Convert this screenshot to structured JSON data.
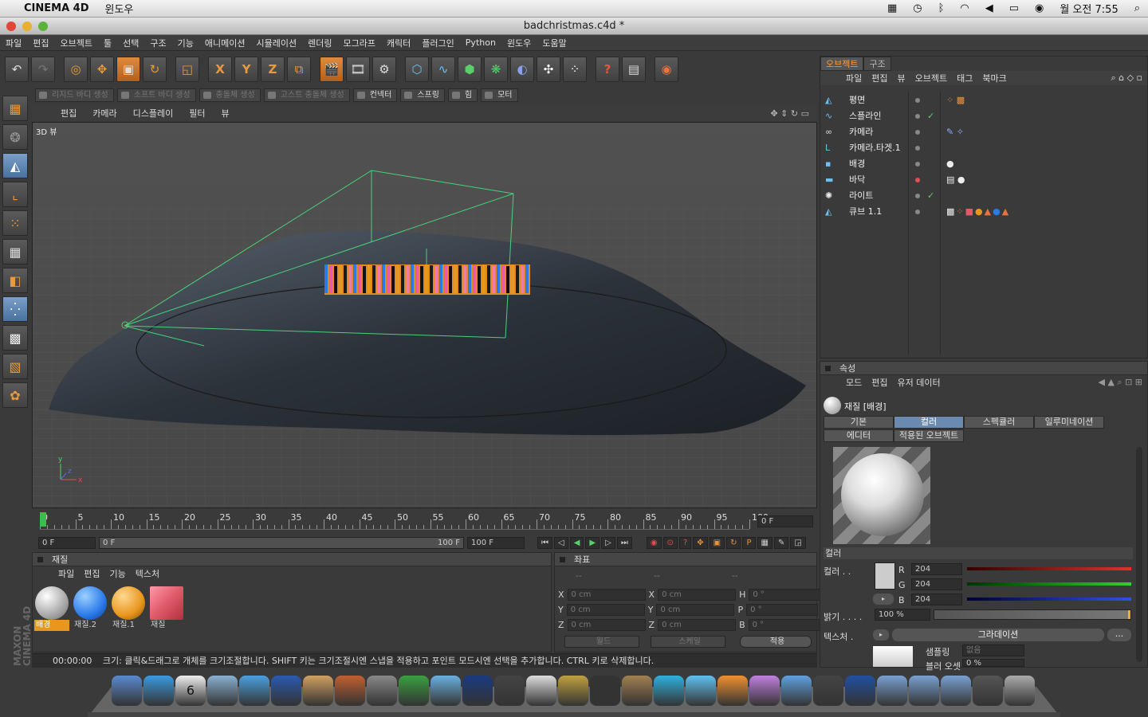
{
  "mac_menubar": {
    "app_name": "CINEMA 4D",
    "window_menu": "윈도우",
    "clock": "월 오전 7:55"
  },
  "window": {
    "title": "badchristmas.c4d *"
  },
  "c4d_menu": [
    "파일",
    "편집",
    "오브젝트",
    "툴",
    "선택",
    "구조",
    "기능",
    "애니메이션",
    "시뮬레이션",
    "렌더링",
    "모그라프",
    "캐릭터",
    "플러그인",
    "Python",
    "윈도우",
    "도움말"
  ],
  "toolbar": {
    "icons": [
      "undo-icon",
      "redo-icon",
      "live-select-icon",
      "move-icon",
      "scale-icon",
      "rotate-icon",
      "model-mode-icon",
      "x-axis-icon",
      "y-axis-icon",
      "z-axis-icon",
      "coord-system-icon",
      "render-view-icon",
      "render-picture-icon",
      "render-settings-icon",
      "cube-icon",
      "spline-icon",
      "nurbs-icon",
      "array-icon",
      "deformer-icon",
      "scene-icon",
      "particles-icon",
      "help-icon",
      "script-icon",
      "web-icon"
    ],
    "glyphs": [
      "↶",
      "↷",
      "◎",
      "✥",
      "▣",
      "↻",
      "◱",
      "X",
      "Y",
      "Z",
      "⧉",
      "🎬",
      "🎞",
      "⚙",
      "⬡",
      "∿",
      "⬢",
      "❋",
      "◐",
      "✣",
      "⁘",
      "?",
      "▤",
      "◉"
    ]
  },
  "dynamics_bar": [
    "리지드 바디 생성",
    "소프트 바디 생성",
    "충돌체 생성",
    "고스트 충돌체 생성",
    "컨넥터",
    "스프링",
    "힘",
    "모터"
  ],
  "viewport": {
    "menu": [
      "편집",
      "카메라",
      "디스플레이",
      "필터",
      "뷰"
    ],
    "label": "3D 뷰",
    "axis_x": "x",
    "axis_y": "y",
    "axis_z": "z"
  },
  "timeline": {
    "ticks": [
      "0",
      "5",
      "10",
      "15",
      "20",
      "25",
      "30",
      "35",
      "40",
      "45",
      "50",
      "55",
      "60",
      "65",
      "70",
      "75",
      "80",
      "85",
      "90",
      "95",
      "100"
    ],
    "current_frame": "0 F",
    "start": "0 F",
    "range_start": "0 F",
    "range_end": "100 F",
    "end": "100 F"
  },
  "material_panel": {
    "title": "재질",
    "menu": [
      "파일",
      "편집",
      "기능",
      "텍스처"
    ],
    "materials": [
      {
        "name": "배경",
        "color": "#e8e8e8",
        "selected": true
      },
      {
        "name": "재질.2",
        "color": "#2a7ae8",
        "selected": false
      },
      {
        "name": "재질.1",
        "color": "#e8961e",
        "selected": false
      },
      {
        "name": "재질",
        "color": "#e05a6a",
        "selected": false
      }
    ]
  },
  "coord_panel": {
    "title": "좌표",
    "headers": [
      "--",
      "--",
      "--"
    ],
    "rows": [
      {
        "a": "X",
        "a_val": "0 cm",
        "b": "X",
        "b_val": "0 cm",
        "c": "H",
        "c_val": "0 °"
      },
      {
        "a": "Y",
        "a_val": "0 cm",
        "b": "Y",
        "b_val": "0 cm",
        "c": "P",
        "c_val": "0 °"
      },
      {
        "a": "Z",
        "a_val": "0 cm",
        "b": "Z",
        "b_val": "0 cm",
        "c": "B",
        "c_val": "0 °"
      }
    ],
    "mode1": "월드",
    "mode2": "스케일",
    "apply": "적용"
  },
  "status": {
    "time": "00:00:00",
    "message": "크기: 클릭&드래그로 개체를 크기조절합니다. SHIFT 키는 크기조절시엔 스냅을 적용하고 포인트 모드시엔 선택을 추가합니다. CTRL 키로 삭제합니다."
  },
  "object_panel": {
    "tabs": [
      "오브젝트",
      "구조"
    ],
    "menu": [
      "파일",
      "편집",
      "뷰",
      "오브젝트",
      "태그",
      "북마크"
    ],
    "objects": [
      "평면",
      "스플라인",
      "카메라",
      "카메라.타겟.1",
      "배경",
      "바닥",
      "라이트",
      "큐브 1.1"
    ]
  },
  "attr_panel": {
    "title": "속성",
    "menu": [
      "모드",
      "편집",
      "유저 데이터"
    ],
    "material_name": "재질 [배경]",
    "tabs_row1": [
      "기본",
      "컬러",
      "스펙큘러",
      "일루미네이션"
    ],
    "tabs_row2": [
      "에디터",
      "적용된 오브젝트"
    ],
    "section": "컬러",
    "color_label": "컬러 . .",
    "r_label": "R",
    "r": "204",
    "g_label": "G",
    "g": "204",
    "b_label": "B",
    "b": "204",
    "brightness_label": "밝기 . . . .",
    "brightness": "100 %",
    "texture_label": "텍스처 .",
    "texture_value": "그라데이션",
    "more": "...",
    "sampling_label": "샘플링",
    "sampling_value": "없음",
    "blur_label": "블러 오셋",
    "blur_value": "0 %"
  },
  "brand": {
    "line1": "MAXON",
    "line2": "CINEMA 4D"
  },
  "dock": {
    "calendar_day": "6"
  }
}
